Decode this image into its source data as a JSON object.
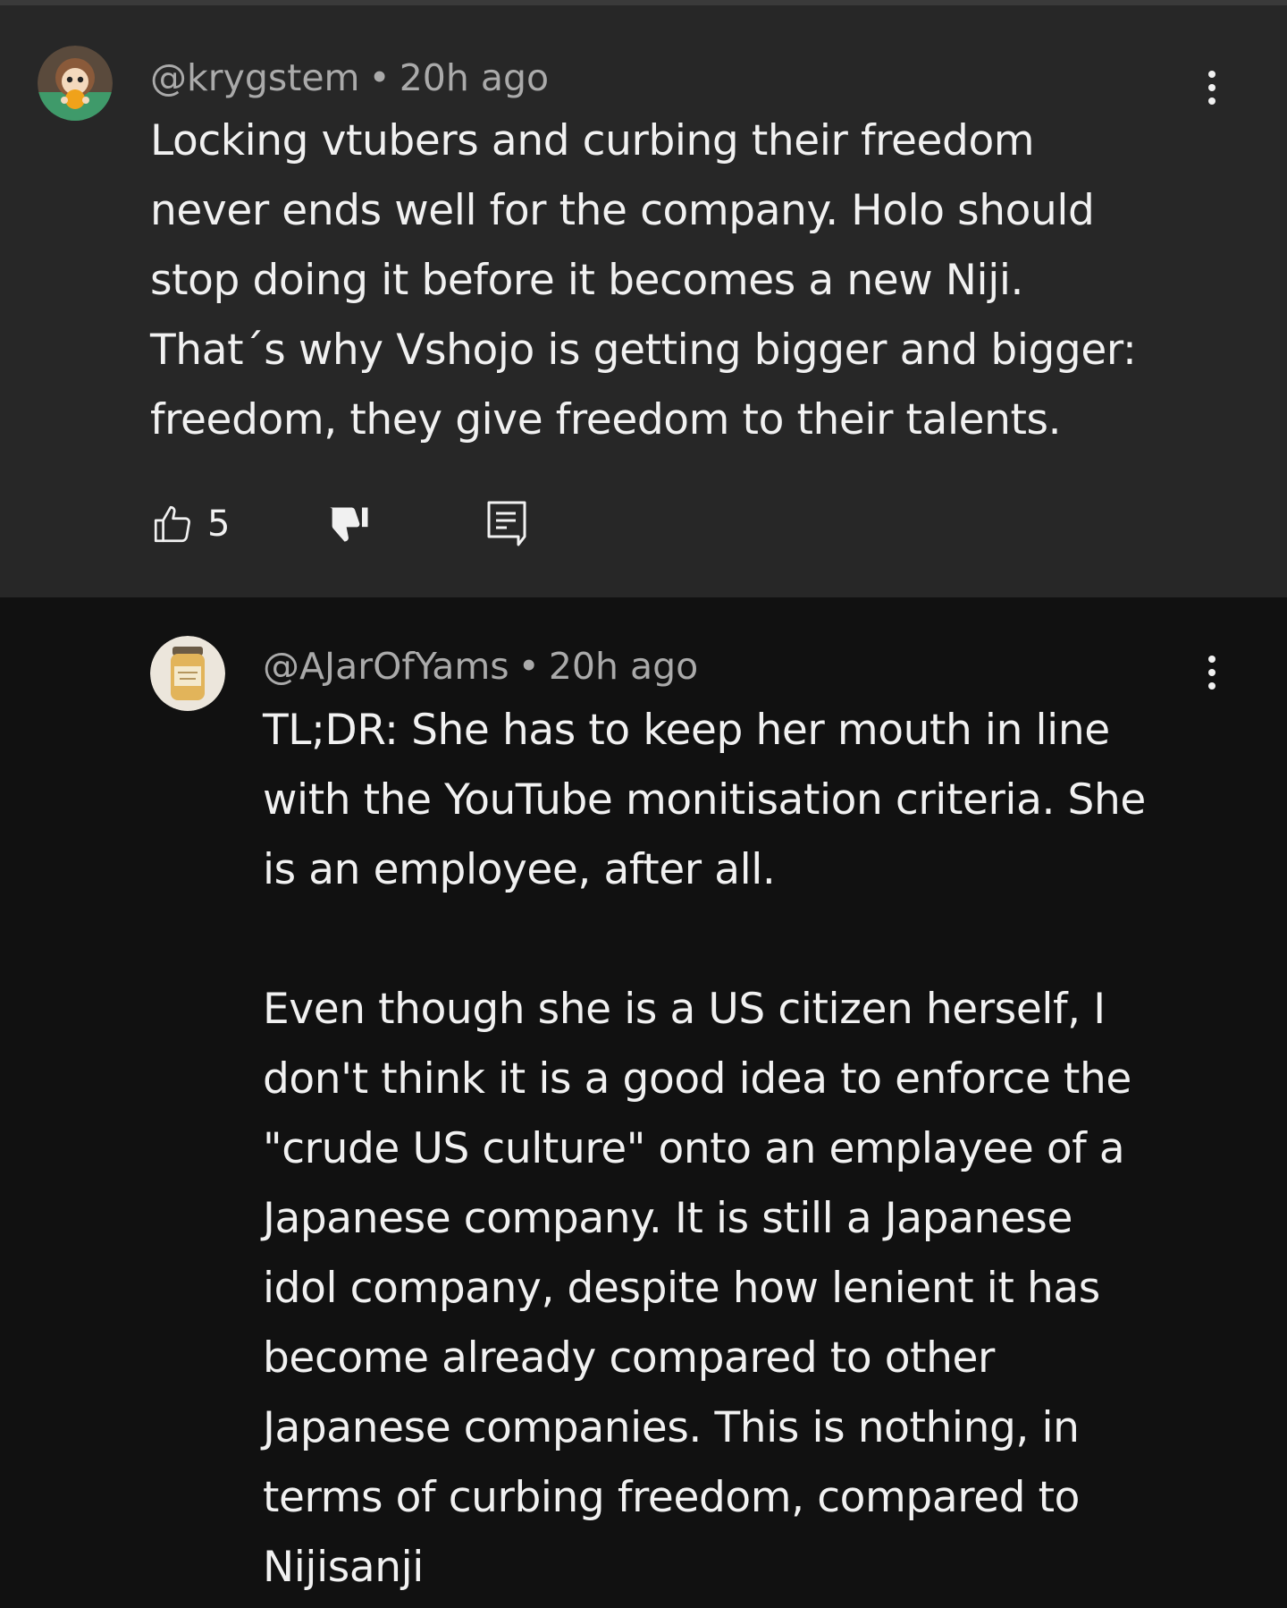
{
  "parent_comment": {
    "author": "@krygstem",
    "separator": "•",
    "time": "20h ago",
    "text": "Locking vtubers and curbing their freedom\nnever ends well for the company. Holo should\nstop doing it before it becomes a new Niji.\nThat´s why Vshojo is getting bigger and bigger:\nfreedom, they give freedom to their talents.",
    "like_count": "5",
    "icons": {
      "avatar": "avatar-character",
      "like": "thumbs-up-outline-icon",
      "dislike": "thumbs-down-filled-icon",
      "reply": "reply-comment-icon",
      "more": "more-vertical-icon"
    }
  },
  "reply_comment": {
    "author": "@AJarOfYams",
    "separator": "•",
    "time": "20h ago",
    "text": "TL;DR: She has to keep her mouth in line\nwith the YouTube monitisation criteria. She\nis an employee, after all.\n\nEven though she is a US citizen herself, I\ndon't think it is a good idea to enforce the\n\"crude US culture\" onto an emplayee of a\nJapanese company. It is still a Japanese\nidol company, despite how lenient it has\nbecome already compared to other\nJapanese companies. This is nothing, in\nterms of curbing freedom, compared to\nNijisanji",
    "icons": {
      "avatar": "avatar-jar",
      "more": "more-vertical-icon"
    }
  },
  "colors": {
    "parent_background": "#272727",
    "page_background": "#111111",
    "meta_text": "#aaaaaa",
    "body_text": "#f1f1f1"
  }
}
